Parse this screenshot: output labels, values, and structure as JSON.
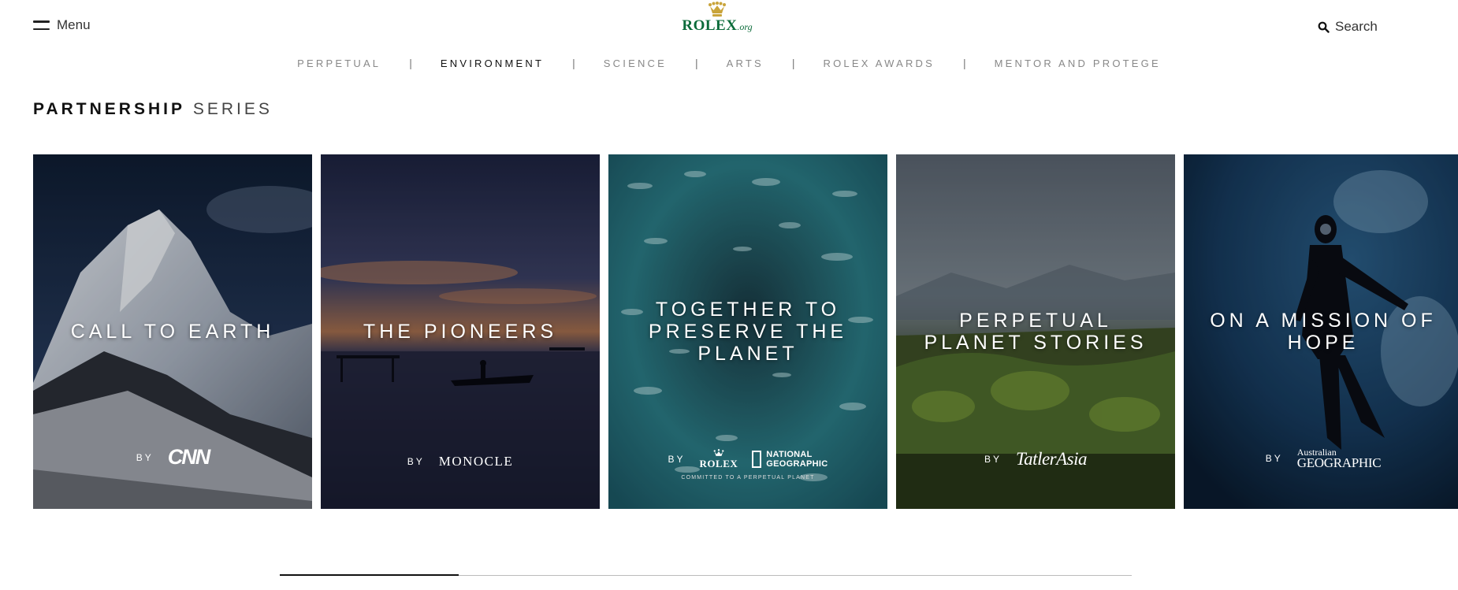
{
  "header": {
    "menu_label": "Menu",
    "search_label": "Search",
    "logo": {
      "text": "ROLEX",
      "suffix": ".org",
      "color": "#0b6b3a"
    }
  },
  "nav": {
    "items": [
      {
        "label": "PERPETUAL",
        "active": false
      },
      {
        "label": "ENVIRONMENT",
        "active": true
      },
      {
        "label": "SCIENCE",
        "active": false
      },
      {
        "label": "ARTS",
        "active": false
      },
      {
        "label": "ROLEX AWARDS",
        "active": false
      },
      {
        "label": "MENTOR AND PROTEGE",
        "active": false
      }
    ]
  },
  "section": {
    "title_bold": "PARTNERSHIP",
    "title_light": "SERIES"
  },
  "cards": [
    {
      "title": "CALL TO EARTH",
      "by": "BY",
      "brand": "CNN"
    },
    {
      "title": "THE PIONEERS",
      "by": "BY",
      "brand": "MONOCLE"
    },
    {
      "title": "TOGETHER TO PRESERVE THE PLANET",
      "by": "BY",
      "brand_rolex": "ROLEX",
      "brand_natgeo_1": "NATIONAL",
      "brand_natgeo_2": "GEOGRAPHIC",
      "subtitle": "COMMITTED TO A PERPETUAL PLANET"
    },
    {
      "title": "PERPETUAL PLANET STORIES",
      "by": "BY",
      "brand": "TatlerAsia"
    },
    {
      "title": "ON A MISSION OF HOPE",
      "by": "BY",
      "brand_ag_1": "Australian",
      "brand_ag_2": "GEOGRAPHIC"
    }
  ],
  "carousel": {
    "progress_fraction": 0.21
  },
  "icons": [
    "hamburger-icon",
    "crown-icon",
    "search-icon"
  ]
}
